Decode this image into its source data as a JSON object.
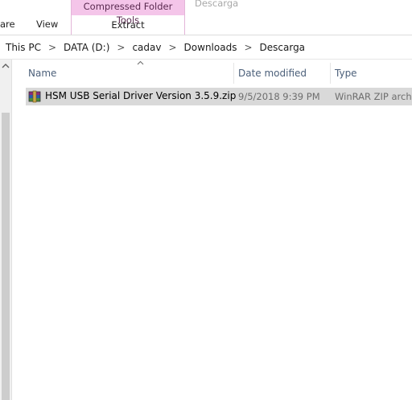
{
  "ribbon": {
    "tabs": {
      "share": "are",
      "view": "View"
    },
    "context_group": {
      "header": "Compressed Folder Tools",
      "tab": "Extract"
    },
    "window_title": "Descarga"
  },
  "address": {
    "crumbs": [
      "This PC",
      "DATA (D:)",
      "cadav",
      "Downloads",
      "Descarga"
    ],
    "separator": ">"
  },
  "columns": {
    "name": "Name",
    "date": "Date modified",
    "type": "Type"
  },
  "files": [
    {
      "name": "HSM USB Serial Driver Version 3.5.9.zip",
      "date": "9/5/2018 9:39 PM",
      "type": "WinRAR ZIP archive",
      "icon": "winrar-archive-icon"
    }
  ],
  "colors": {
    "context_tab": "#f4c5e9",
    "selection": "#d9d9d9"
  }
}
